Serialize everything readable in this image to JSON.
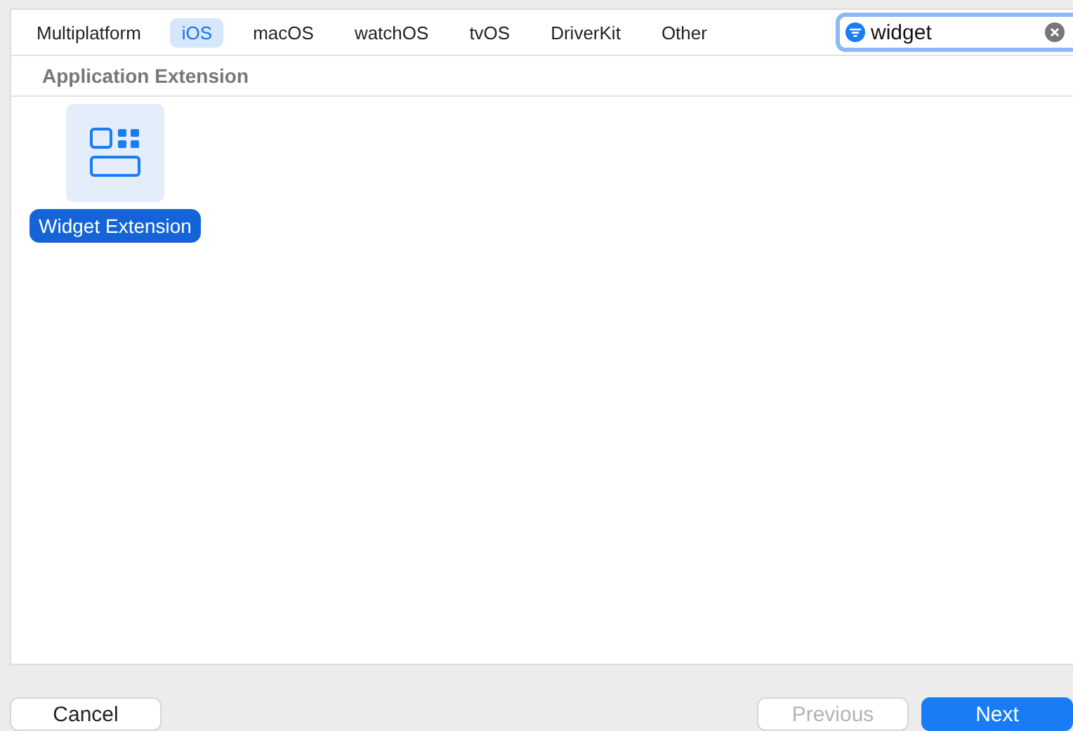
{
  "tabs": [
    {
      "label": "Multiplatform",
      "selected": false
    },
    {
      "label": "iOS",
      "selected": true
    },
    {
      "label": "macOS",
      "selected": false
    },
    {
      "label": "watchOS",
      "selected": false
    },
    {
      "label": "tvOS",
      "selected": false
    },
    {
      "label": "DriverKit",
      "selected": false
    },
    {
      "label": "Other",
      "selected": false
    }
  ],
  "search": {
    "value": "widget"
  },
  "section": {
    "title": "Application Extension"
  },
  "templates": [
    {
      "label": "Widget Extension",
      "selected": true
    }
  ],
  "buttons": [
    {
      "label": "Cancel",
      "kind": "normal",
      "disabled": false
    },
    {
      "label": "Previous",
      "kind": "normal",
      "disabled": true
    },
    {
      "label": "Next",
      "kind": "primary",
      "disabled": false
    }
  ]
}
